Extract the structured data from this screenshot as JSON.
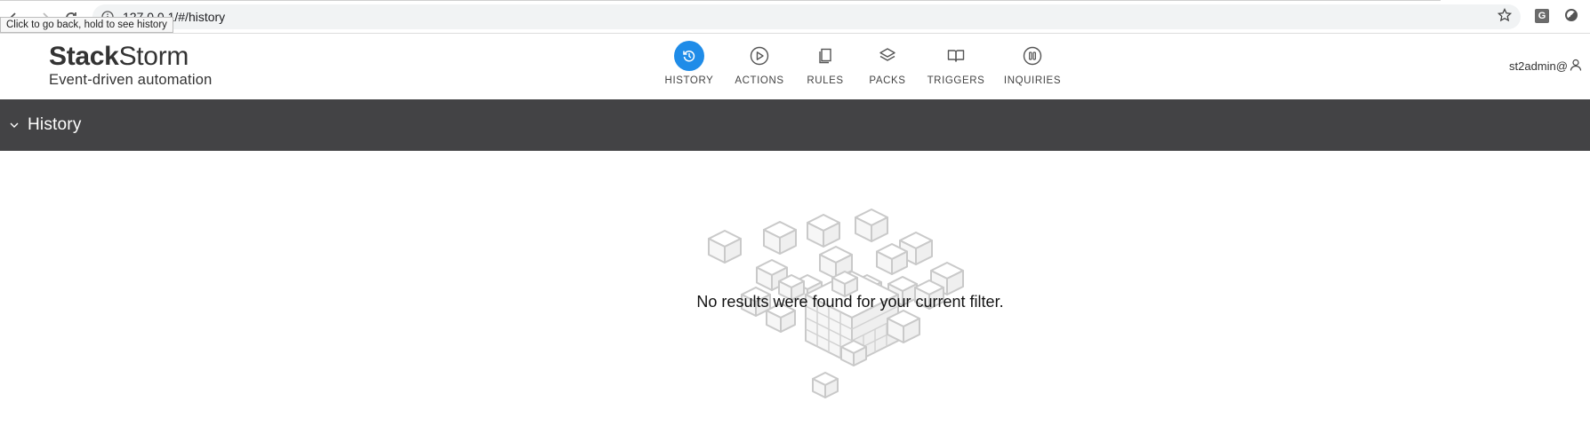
{
  "browser": {
    "url": "127.0.0.1/#/history",
    "tooltip": "Click to go back, hold to see history",
    "extension_label": "G"
  },
  "brand": {
    "name_bold": "Stack",
    "name_light": "Storm",
    "tagline": "Event-driven automation"
  },
  "nav": {
    "accent": "#1f8ce8",
    "items": [
      {
        "label": "HISTORY",
        "icon": "history-icon",
        "active": true
      },
      {
        "label": "ACTIONS",
        "icon": "play-circle-icon",
        "active": false
      },
      {
        "label": "RULES",
        "icon": "copy-icon",
        "active": false
      },
      {
        "label": "PACKS",
        "icon": "layers-icon",
        "active": false
      },
      {
        "label": "TRIGGERS",
        "icon": "book-icon",
        "active": false
      },
      {
        "label": "INQUIRIES",
        "icon": "pause-circle-icon",
        "active": false
      }
    ]
  },
  "user": {
    "name": "st2admin@",
    "icon": "user-icon"
  },
  "section": {
    "title": "History",
    "icon": "chevron-down-icon",
    "bar_color": "#434345"
  },
  "empty_state": {
    "message": "No results were found for your current filter.",
    "illustration": "cubes-illustration"
  }
}
